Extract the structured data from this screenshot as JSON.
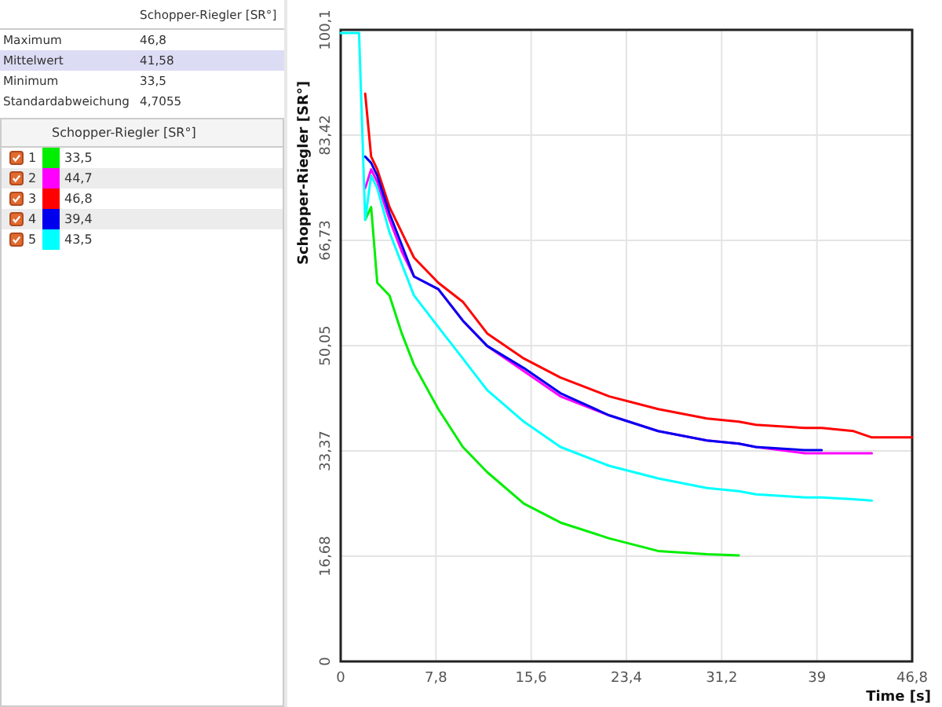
{
  "stats": {
    "column": "Schopper-Riegler [SR°]",
    "rows": [
      {
        "label": "Maximum",
        "value": "46,8",
        "selected": false
      },
      {
        "label": "Mittelwert",
        "value": "41,58",
        "selected": true
      },
      {
        "label": "Minimum",
        "value": "33,5",
        "selected": false
      },
      {
        "label": "Standardabweichung",
        "value": "4,7055",
        "selected": false
      }
    ]
  },
  "samples": {
    "column": "Schopper-Riegler [SR°]",
    "rows": [
      {
        "number": "1",
        "checked": true,
        "color": "#00ee00",
        "value": "33,5"
      },
      {
        "number": "2",
        "checked": true,
        "color": "#ff00ff",
        "value": "44,7"
      },
      {
        "number": "3",
        "checked": true,
        "color": "#ff0000",
        "value": "46,8"
      },
      {
        "number": "4",
        "checked": true,
        "color": "#0000ee",
        "value": "39,4"
      },
      {
        "number": "5",
        "checked": true,
        "color": "#00ffff",
        "value": "43,5"
      }
    ]
  },
  "chart": {
    "chart_data": {
      "type": "line",
      "xlabel": "Time [s]",
      "ylabel": "Schopper-Riegler [SR°]",
      "x": [
        0,
        1.5,
        2,
        2.5,
        3,
        4,
        5,
        6,
        8,
        10,
        12,
        15,
        18,
        22,
        26,
        30,
        32.6,
        34,
        38,
        39.4,
        42,
        43.5,
        46.8
      ],
      "series": [
        {
          "color": "#00ee00",
          "values": [
            null,
            null,
            70,
            72,
            60,
            58,
            52,
            47,
            40,
            34,
            30,
            25,
            22,
            19.5,
            17.5,
            17,
            16.8,
            null,
            null,
            null,
            null,
            null,
            null
          ]
        },
        {
          "color": "#ff00ff",
          "values": [
            null,
            null,
            75,
            78,
            76,
            70,
            65,
            61,
            59,
            54,
            50,
            46,
            42,
            39,
            36.5,
            35,
            34.5,
            34,
            33,
            33,
            33,
            33,
            null
          ]
        },
        {
          "color": "#ff0000",
          "values": [
            null,
            null,
            90,
            80,
            78,
            72,
            68,
            64,
            60,
            57,
            52,
            48,
            45,
            42,
            40,
            38.5,
            38,
            37.5,
            37,
            37,
            36.5,
            35.5,
            35.5
          ]
        },
        {
          "color": "#0000ee",
          "values": [
            null,
            null,
            80,
            79,
            77,
            71,
            66,
            61,
            59,
            54,
            50,
            46.5,
            42.5,
            39,
            36.5,
            35,
            34.5,
            34,
            33.5,
            33.5,
            null,
            null,
            null
          ]
        },
        {
          "color": "#00ffff",
          "values": [
            99.6,
            99.6,
            70,
            77,
            75,
            68,
            63,
            58,
            53,
            48,
            43,
            38,
            34,
            31,
            29,
            27.5,
            27,
            26.5,
            26,
            26,
            25.7,
            25.5,
            null
          ]
        }
      ],
      "grid": true,
      "xlim": [
        0,
        46.8
      ],
      "ylim": [
        0,
        100.1
      ],
      "xticks": [
        0,
        {
          "value": 7.8,
          "label": "7,8"
        },
        {
          "value": 15.6,
          "label": "15,6"
        },
        {
          "value": 23.4,
          "label": "23,4"
        },
        {
          "value": 31.2,
          "label": "31,2"
        },
        39,
        {
          "value": 46.8,
          "label": "46,8"
        }
      ],
      "yticks": [
        0,
        {
          "value": 16.68,
          "label": "16,68"
        },
        {
          "value": 33.37,
          "label": "33,37"
        },
        {
          "value": 50.05,
          "label": "50,05"
        },
        {
          "value": 66.73,
          "label": "66,73"
        },
        {
          "value": 83.42,
          "label": "83,42"
        },
        {
          "value": 100.1,
          "label": "100,1"
        }
      ]
    }
  }
}
